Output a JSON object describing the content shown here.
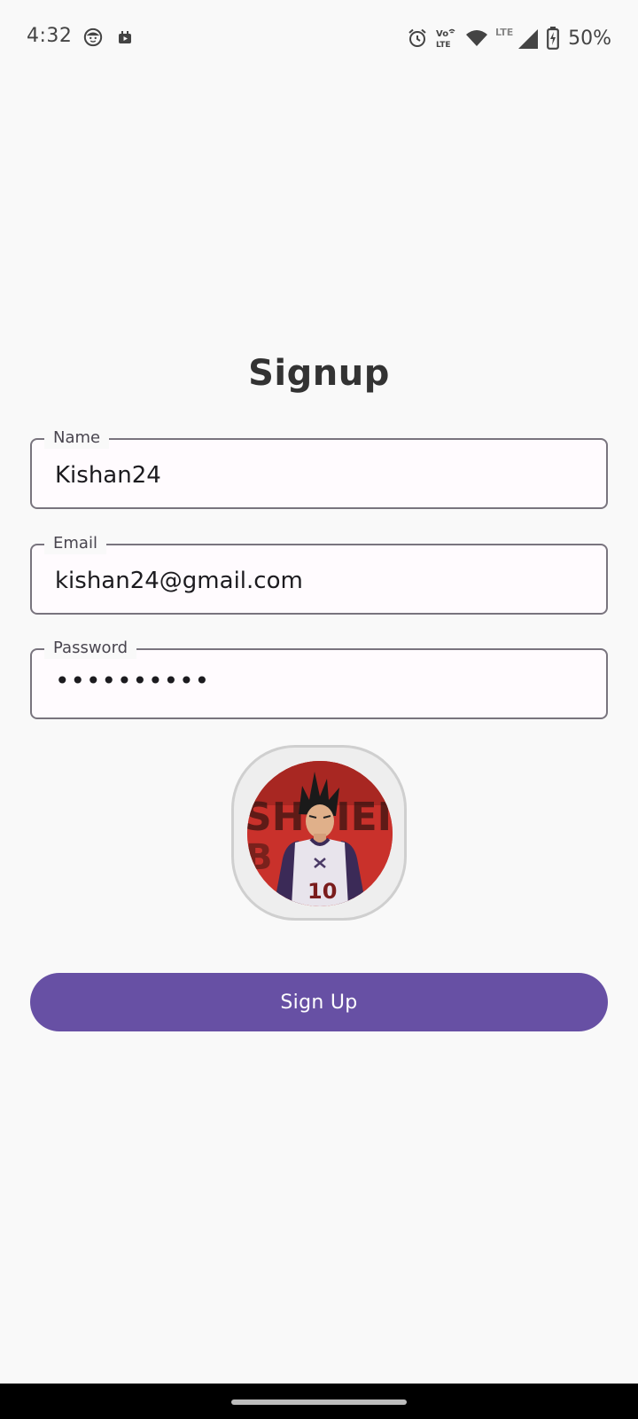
{
  "status_bar": {
    "time": "4:32",
    "battery_percent": "50%",
    "icons": [
      "face-notification-icon",
      "media-notification-icon",
      "alarm-icon",
      "volte-icon",
      "wifi-icon",
      "lte-signal-icon",
      "battery-charging-icon"
    ],
    "volte_top": "Vo",
    "volte_bottom": "LTE",
    "lte_label": "LTE"
  },
  "form": {
    "title": "Signup",
    "name": {
      "label": "Name",
      "value": "Kishan24"
    },
    "email": {
      "label": "Email",
      "value": "kishan24@gmail.com"
    },
    "password": {
      "label": "Password",
      "value": "••••••••••"
    },
    "avatar": {
      "jersey_number": "10",
      "background_text": "SHUIEI"
    },
    "submit_label": "Sign Up"
  },
  "colors": {
    "primary": "#6750a4",
    "outline": "#79747e",
    "background": "#f9f9f9"
  }
}
